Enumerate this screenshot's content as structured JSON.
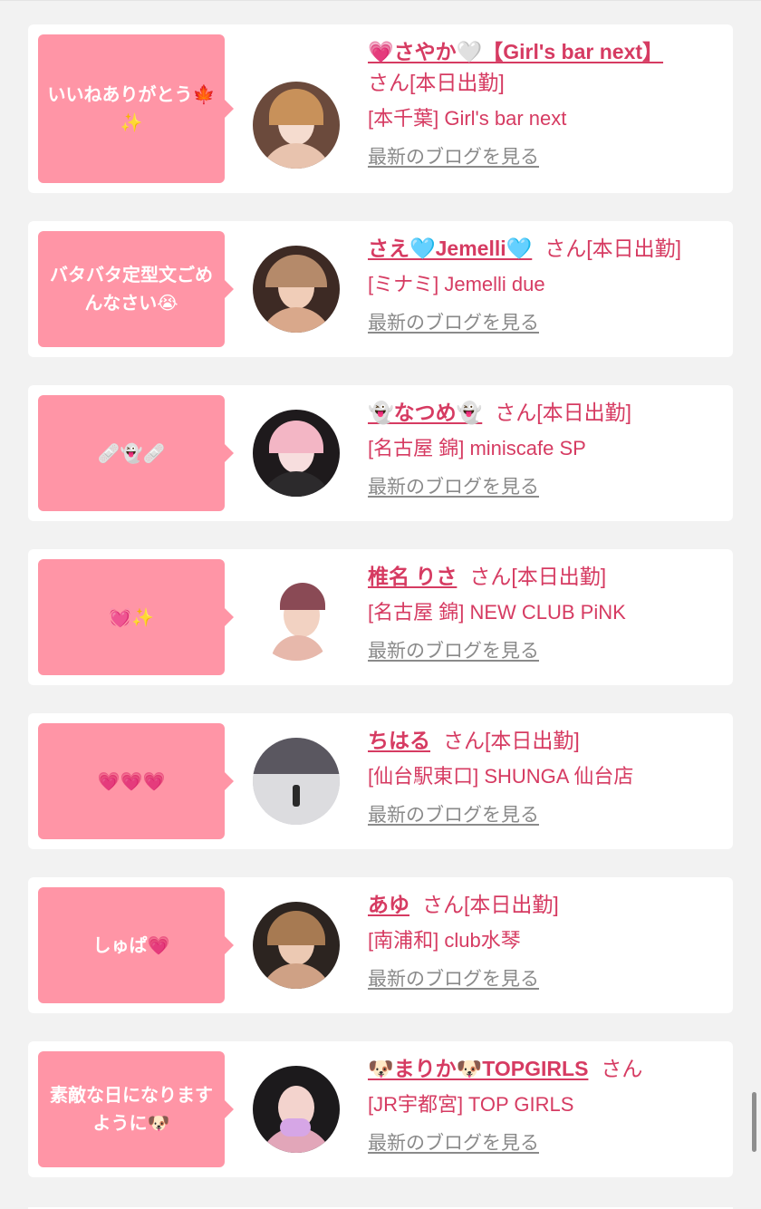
{
  "colors": {
    "page_bg": "#f2f2f2",
    "card_bg": "#ffffff",
    "bubble_bg": "#ff95a6",
    "accent": "#d63b62",
    "link_gray": "#8a8a8a"
  },
  "cards": [
    {
      "message": "いいねありがとう🍁✨",
      "name": "💗さやか🤍【Girl's bar next】",
      "suffix": "さん",
      "status": "[本日出勤]",
      "shop": "[本千葉] Girl's bar next",
      "blog_link": "最新のブログを見る",
      "avatar_icon": "girl-photo"
    },
    {
      "message": "バタバタ定型文ごめんなさい😭",
      "name": "さえ🩵Jemelli🩵",
      "suffix": "さん",
      "status": "[本日出勤]",
      "shop": "[ミナミ] Jemelli due",
      "blog_link": "最新のブログを見る",
      "avatar_icon": "girl-photo"
    },
    {
      "message": "🩹👻🩹",
      "name": "👻なつめ👻",
      "suffix": "さん",
      "status": "[本日出勤]",
      "shop": "[名古屋 錦] miniscafe SP",
      "blog_link": "最新のブログを見る",
      "avatar_icon": "girl-photo"
    },
    {
      "message": "💓✨",
      "name": "椎名 りさ",
      "suffix": "さん",
      "status": "[本日出勤]",
      "shop": "[名古屋 錦] NEW CLUB PiNK",
      "blog_link": "最新のブログを見る",
      "avatar_icon": "girl-photo"
    },
    {
      "message": "💗💗💗",
      "name": "ちはる",
      "suffix": "さん",
      "status": "[本日出勤]",
      "shop": "[仙台駅東口] SHUNGA 仙台店",
      "blog_link": "最新のブログを見る",
      "avatar_icon": "snow-photo"
    },
    {
      "message": "しゅぱ💗",
      "name": "あゆ",
      "suffix": "さん",
      "status": "[本日出勤]",
      "shop": "[南浦和] club水琴",
      "blog_link": "最新のブログを見る",
      "avatar_icon": "girl-photo"
    },
    {
      "message": "素敵な日になりますように🐶",
      "name": "🐶まりか🐶TOPGIRLS",
      "suffix": "さん",
      "status": "",
      "shop": "[JR宇都宮] TOP GIRLS",
      "blog_link": "最新のブログを見る",
      "avatar_icon": "girl-photo"
    }
  ]
}
